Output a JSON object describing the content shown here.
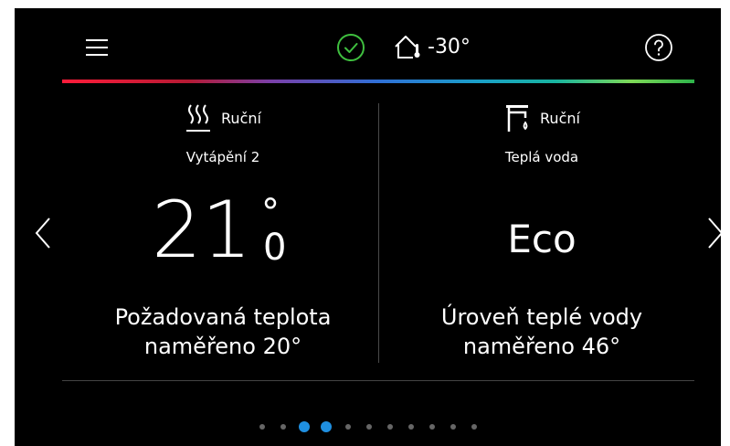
{
  "header": {
    "menu_icon": "hamburger-menu-icon",
    "status_icon": "check-circle-icon",
    "outdoor_icon": "house-thermometer-icon",
    "outdoor_temp": "-30°",
    "help_icon": "help-circle-icon",
    "status_color": "#3fbf3f"
  },
  "heating": {
    "mode_icon": "heating-waves-icon",
    "mode": "Ruční",
    "zone": "Vytápění 2",
    "temp_integer": "21",
    "temp_degree": "°",
    "temp_decimal": "0",
    "desc_line1": "Požadovaná teplota",
    "desc_line2": "naměřeno 20°"
  },
  "hot_water": {
    "mode_icon": "water-tap-icon",
    "mode": "Ruční",
    "zone": "Teplá voda",
    "level": "Eco",
    "desc_line1": "Úroveň teplé vody",
    "desc_line2": "naměřeno 46°"
  },
  "navigation": {
    "prev_icon": "chevron-left-icon",
    "next_icon": "chevron-right-icon"
  },
  "pager": {
    "total": 11,
    "active": [
      2,
      3
    ],
    "active_color": "#1f8fe0"
  }
}
